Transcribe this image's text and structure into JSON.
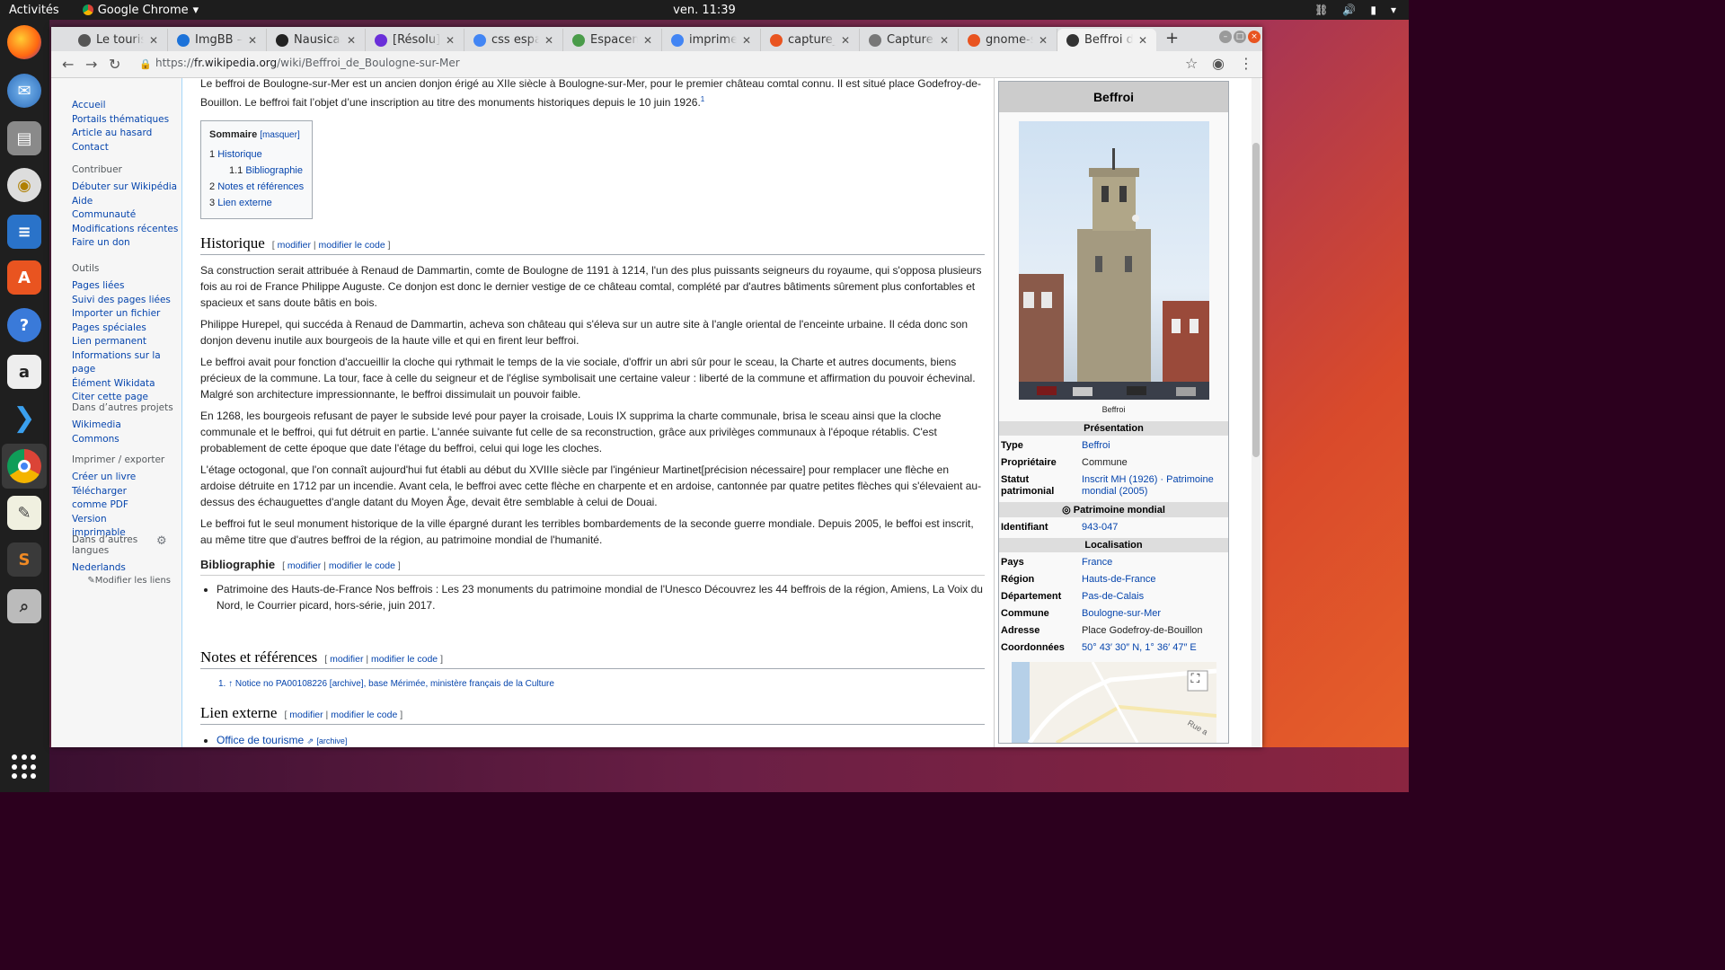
{
  "topbar": {
    "activities": "Activités",
    "app": "Google Chrome",
    "clock": "ven. 11:39"
  },
  "dock": {
    "items": [
      "firefox-icon",
      "thunderbird-icon",
      "files-icon",
      "rhythmbox-icon",
      "writer-icon",
      "software-icon",
      "help-icon",
      "amazon-icon",
      "vscode-icon",
      "chrome-icon",
      "text-editor-icon",
      "sublime-icon",
      "screenshot-tool-icon"
    ]
  },
  "tabs": [
    {
      "label": "Le tourism",
      "color": "#555"
    },
    {
      "label": "ImgBB — I",
      "color": "#1c72d9"
    },
    {
      "label": "Nausicaá c",
      "color": "#222"
    },
    {
      "label": "[Résolu] [C",
      "color": "#6a2fd9"
    },
    {
      "label": "css espace",
      "color": "#4285f4"
    },
    {
      "label": "Espaceme",
      "color": "#4a9c4a"
    },
    {
      "label": "imprime e",
      "color": "#4285f4"
    },
    {
      "label": "capture_d",
      "color": "#e95420"
    },
    {
      "label": "Captures c",
      "color": "#777"
    },
    {
      "label": "gnome-sc",
      "color": "#e95420"
    },
    {
      "label": "Beffroi de",
      "color": "#333"
    }
  ],
  "address": {
    "scheme": "https://",
    "host": "fr.wikipedia.org",
    "path": "/wiki/Beffroi_de_Boulogne-sur-Mer"
  },
  "sidebar": {
    "nav": [
      "Accueil",
      "Portails thématiques",
      "Article au hasard",
      "Contact"
    ],
    "contribute_title": "Contribuer",
    "contribute": [
      "Débuter sur Wikipédia",
      "Aide",
      "Communauté",
      "Modifications récentes",
      "Faire un don"
    ],
    "tools_title": "Outils",
    "tools": [
      "Pages liées",
      "Suivi des pages liées",
      "Importer un fichier",
      "Pages spéciales",
      "Lien permanent",
      "Informations sur la page",
      "Élément Wikidata",
      "Citer cette page"
    ],
    "projects_title": "Dans d’autres projets",
    "projects": [
      "Wikimedia Commons"
    ],
    "print_title": "Imprimer / exporter",
    "print": [
      "Créer un livre",
      "Télécharger comme PDF",
      "Version imprimable"
    ],
    "lang_title": "Dans d’autres langues",
    "langs": [
      "Nederlands"
    ],
    "edit_links": "Modifier les liens"
  },
  "article": {
    "intro": "Le beffroi de Boulogne-sur-Mer est un ancien donjon érigé au XIIe siècle à Boulogne-sur-Mer, pour le premier château comtal connu. Il est situé place Godefroy-de-Bouillon. Le beffroi fait l’objet d’une inscription au titre des monuments historiques depuis le 10 juin 1926.",
    "intro_ref": "1",
    "toc_title": "Sommaire",
    "toc_toggle": "[masquer]",
    "toc": [
      {
        "num": "1",
        "label": "Historique",
        "indent": false
      },
      {
        "num": "1.1",
        "label": "Bibliographie",
        "indent": true
      },
      {
        "num": "2",
        "label": "Notes et références",
        "indent": false
      },
      {
        "num": "3",
        "label": "Lien externe",
        "indent": false
      }
    ],
    "edit_label": "modifier",
    "edit_code_label": "modifier le code",
    "h_historique": "Historique",
    "p1": "Sa construction serait attribuée à Renaud de Dammartin, comte de Boulogne de 1191 à 1214, l'un des plus puissants seigneurs du royaume, qui s'opposa plusieurs fois au roi de France Philippe Auguste. Ce donjon est donc le dernier vestige de ce château comtal, complété par d'autres bâtiments sûrement plus confortables et spacieux et sans doute bâtis en bois.",
    "p2": "Philippe Hurepel, qui succéda à Renaud de Dammartin, acheva son château qui s'éleva sur un autre site à l'angle oriental de l'enceinte urbaine. Il céda donc son donjon devenu inutile aux bourgeois de la haute ville et qui en firent leur beffroi.",
    "p3": "Le beffroi avait pour fonction d'accueillir la cloche qui rythmait le temps de la vie sociale, d'offrir un abri sûr pour le sceau, la Charte et autres documents, biens précieux de la commune. La tour, face à celle du seigneur et de l'église symbolisait une certaine valeur : liberté de la commune et affirmation du pouvoir échevinal. Malgré son architecture impressionnante, le beffroi dissimulait un pouvoir faible.",
    "p4": "En 1268, les bourgeois refusant de payer le subside levé pour payer la croisade, Louis IX supprima la charte communale, brisa le sceau ainsi que la cloche communale et le beffroi, qui fut détruit en partie. L'année suivante fut celle de sa reconstruction, grâce aux privilèges communaux à l'époque rétablis. C'est probablement de cette époque que date l'étage du beffroi, celui qui loge les cloches.",
    "p5": "L'étage octogonal, que l'on connaît aujourd'hui fut établi au début du XVIIIe siècle par l'ingénieur Martinet[précision nécessaire] pour remplacer une flèche en ardoise détruite en 1712 par un incendie. Avant cela, le beffroi avec cette flèche en charpente et en ardoise, cantonnée par quatre petites flèches qui s'élevaient au-dessus des échauguettes d'angle datant du Moyen Âge, devait être semblable à celui de Douai.",
    "p6": "Le beffroi fut le seul monument historique de la ville épargné durant les terribles bombardements de la seconde guerre mondiale. Depuis 2005, le beffoi est inscrit, au même titre que d'autres beffroi de la région, au patrimoine mondial de l'humanité.",
    "h_biblio": "Bibliographie",
    "biblio": "Patrimoine des Hauts-de-France Nos beffrois : Les 23 monuments du patrimoine mondial de l'Unesco Découvrez les 44 beffrois de la région, Amiens, La Voix du Nord, le Courrier picard, hors-série, juin 2017.",
    "h_notes": "Notes et références",
    "note1": "1. ↑ Notice no PA00108226 [archive], base Mérimée, ministère français de la Culture",
    "h_lien": "Lien externe",
    "lien1": "Office de tourisme",
    "lien1_archive": "[archive]"
  },
  "infobox": {
    "title": "Beffroi",
    "caption": "Beffroi",
    "sec_presentation": "Présentation",
    "rows1": [
      {
        "k": "Type",
        "v": "Beffroi"
      },
      {
        "k": "Propriétaire",
        "v": "Commune"
      },
      {
        "k": "Statut patrimonial",
        "v": "Inscrit MH (1926) · Patrimoine mondial (2005)"
      }
    ],
    "sec_unesco": "Patrimoine mondial",
    "rows2": [
      {
        "k": "Identifiant",
        "v": "943-047"
      }
    ],
    "sec_loc": "Localisation",
    "rows3": [
      {
        "k": "Pays",
        "v": "France"
      },
      {
        "k": "Région",
        "v": "Hauts-de-France"
      },
      {
        "k": "Département",
        "v": "Pas-de-Calais"
      },
      {
        "k": "Commune",
        "v": "Boulogne-sur-Mer"
      },
      {
        "k": "Adresse",
        "v": "Place Godefroy-de-Bouillon"
      },
      {
        "k": "Coordonnées",
        "v": "50° 43′ 30″ N, 1° 36′ 47″ E"
      }
    ],
    "map_label": "Rue a"
  }
}
